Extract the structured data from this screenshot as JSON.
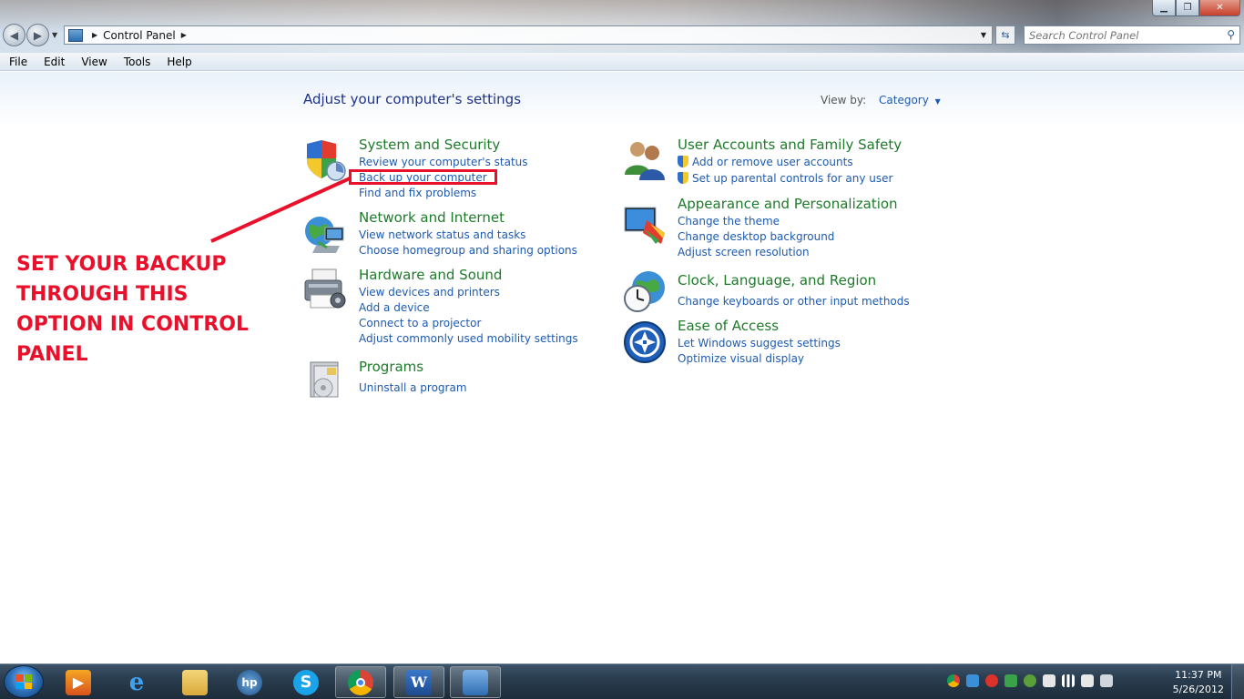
{
  "window": {
    "minimize_label": "▁",
    "maximize_label": "❐",
    "close_label": "✕"
  },
  "address_bar": {
    "location": "Control Panel",
    "search_placeholder": "Search Control Panel"
  },
  "menu": [
    "File",
    "Edit",
    "View",
    "Tools",
    "Help"
  ],
  "main": {
    "heading": "Adjust your computer's settings",
    "view_by_label": "View by:",
    "view_by_value": "Category"
  },
  "categories": [
    {
      "title": "System and Security",
      "icon": "shield-icon",
      "links": [
        "Review your computer's status",
        "Back up your computer",
        "Find and fix problems"
      ]
    },
    {
      "title": "Network and Internet",
      "icon": "network-globe-icon",
      "links": [
        "View network status and tasks",
        "Choose homegroup and sharing options"
      ]
    },
    {
      "title": "Hardware and Sound",
      "icon": "printer-icon",
      "links": [
        "View devices and printers",
        "Add a device",
        "Connect to a projector",
        "Adjust commonly used mobility settings"
      ]
    },
    {
      "title": "Programs",
      "icon": "programs-icon",
      "links": [
        "Uninstall a program"
      ]
    },
    {
      "title": "User Accounts and Family Safety",
      "icon": "users-icon",
      "links": [
        "Add or remove user accounts",
        "Set up parental controls for any user"
      ]
    },
    {
      "title": "Appearance and Personalization",
      "icon": "display-palette-icon",
      "links": [
        "Change the theme",
        "Change desktop background",
        "Adjust screen resolution"
      ]
    },
    {
      "title": "Clock, Language, and Region",
      "icon": "clock-globe-icon",
      "links": [
        "Change keyboards or other input methods"
      ]
    },
    {
      "title": "Ease of Access",
      "icon": "ease-of-access-icon",
      "links": [
        "Let Windows suggest settings",
        "Optimize visual display"
      ]
    }
  ],
  "annotation": {
    "lines": [
      "SET YOUR BACKUP",
      "THROUGH THIS",
      "OPTION IN CONTROL",
      "PANEL"
    ],
    "color": "#e8102a"
  },
  "taskbar": {
    "time": "11:37 PM",
    "date": "5/26/2012",
    "apps": [
      "media-player-icon",
      "internet-explorer-icon",
      "file-explorer-icon",
      "hp-icon",
      "skype-icon",
      "chrome-icon",
      "word-icon",
      "control-panel-icon"
    ]
  },
  "colors": {
    "link": "#1c5ab2",
    "category_title": "#1e7b2a",
    "heading": "#1e3287"
  }
}
